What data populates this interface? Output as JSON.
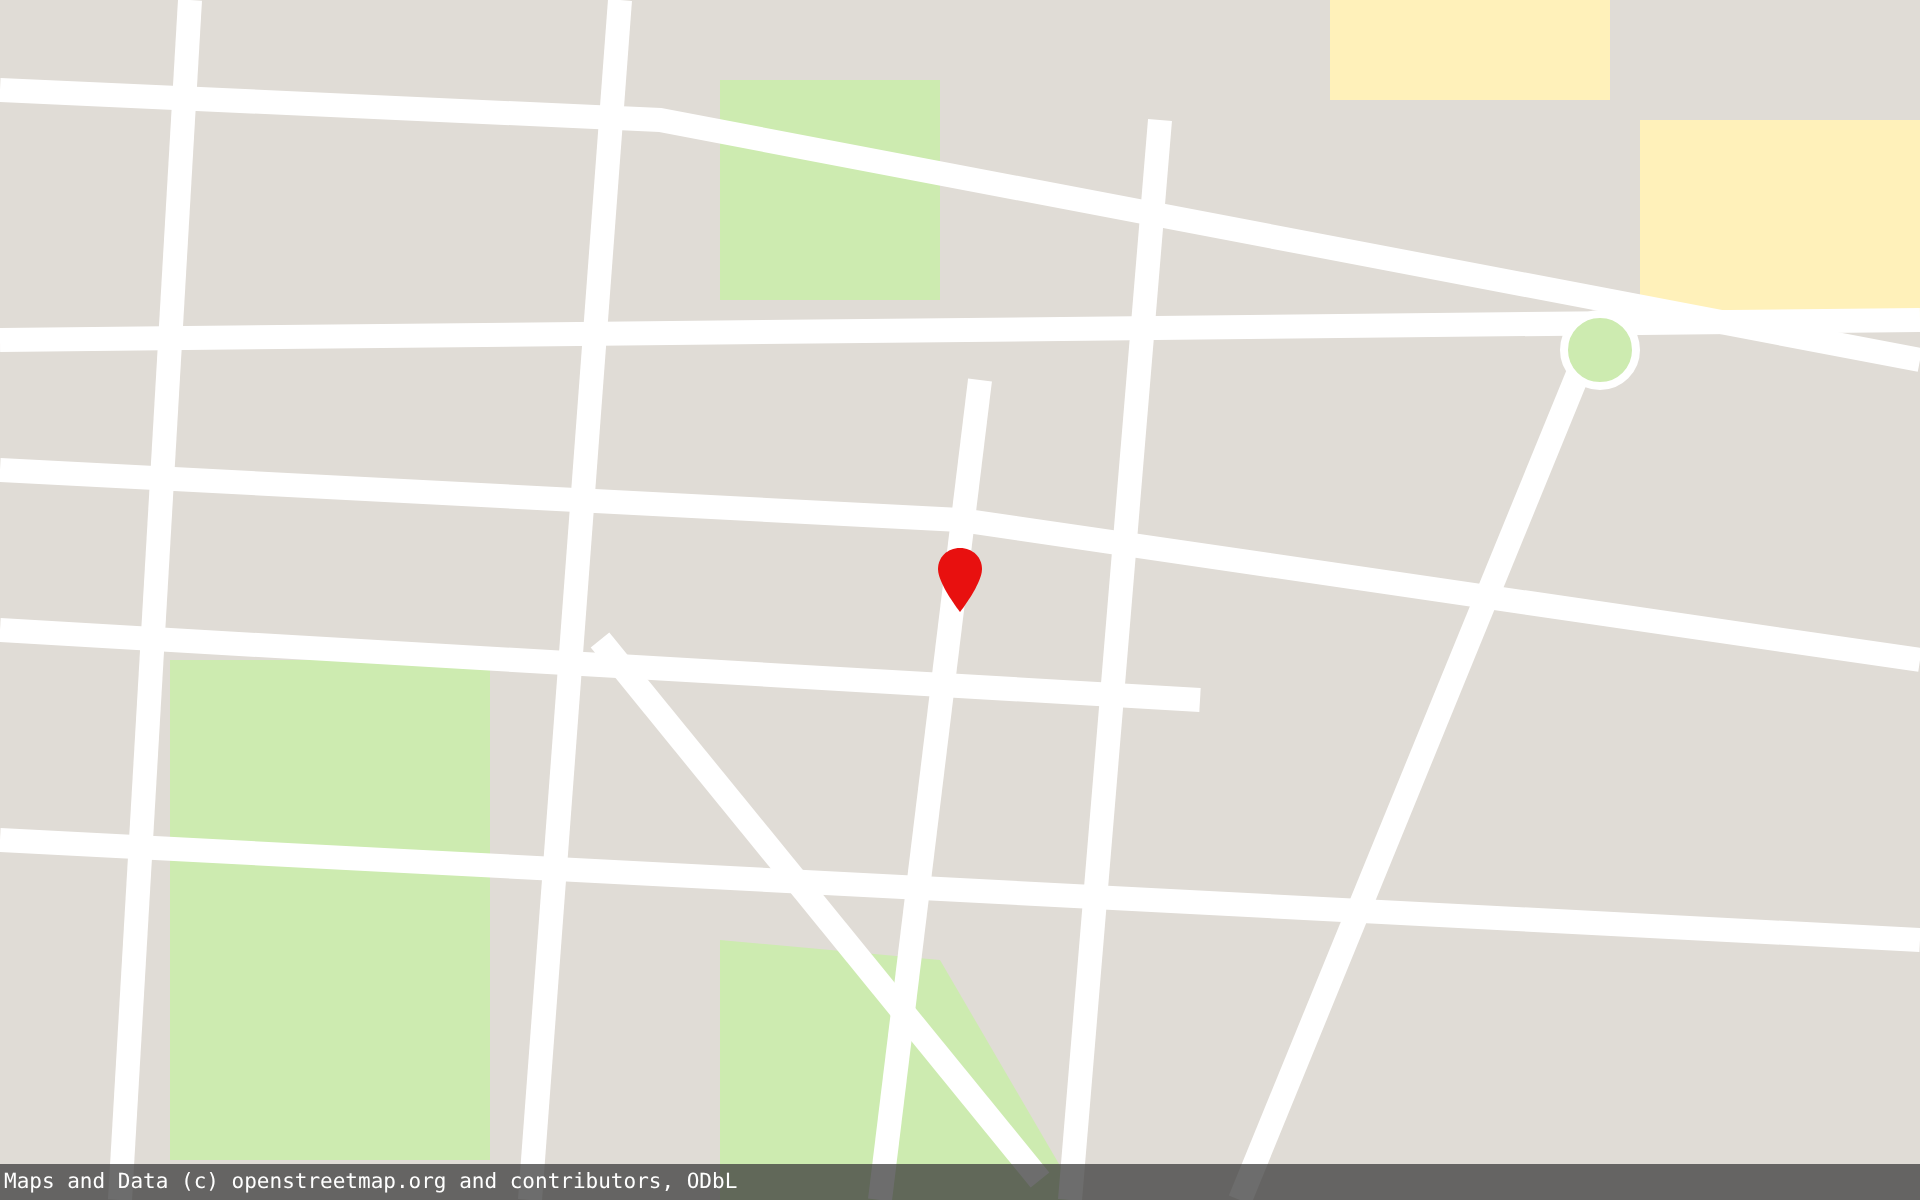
{
  "marker": {
    "color": "#e8100f"
  },
  "attribution": "Maps and Data (c) openstreetmap.org and contributors, ODbL"
}
